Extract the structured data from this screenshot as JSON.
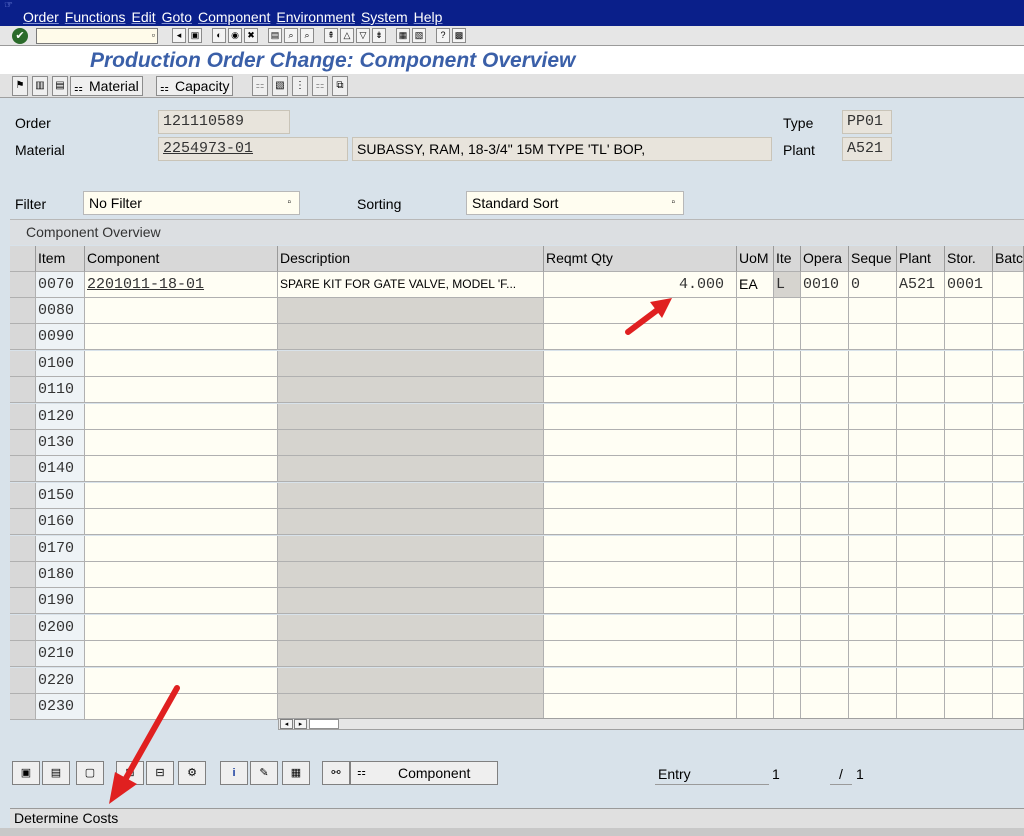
{
  "menu": [
    "Order",
    "Functions",
    "Edit",
    "Goto",
    "Component",
    "Environment",
    "System",
    "Help"
  ],
  "title": "Production Order Change: Component Overview",
  "app_toolbar": {
    "material_label": "Material",
    "capacity_label": "Capacity"
  },
  "header": {
    "order_label": "Order",
    "order_value": "121110589",
    "material_label": "Material",
    "material_value": "2254973-01",
    "material_desc": "SUBASSY, RAM, 18-3/4\" 15M TYPE 'TL' BOP,",
    "type_label": "Type",
    "type_value": "PP01",
    "plant_label": "Plant",
    "plant_value": "A521",
    "filter_label": "Filter",
    "filter_value": "No Filter",
    "sorting_label": "Sorting",
    "sorting_value": "Standard Sort"
  },
  "table": {
    "title": "Component Overview",
    "columns": [
      "Item",
      "Component",
      "Description",
      "Reqmt Qty",
      "UoM",
      "Ite",
      "Opera",
      "Seque",
      "Plant",
      "Stor.",
      "Batch"
    ],
    "first_row": {
      "item": "0070",
      "component": "2201011-18-01",
      "description": "SPARE KIT FOR GATE VALVE, MODEL 'F...",
      "qty": "4.000",
      "uom": "EA",
      "ite": "L",
      "opera": "0010",
      "seque": "0",
      "plant": "A521",
      "stor": "0001"
    },
    "empty_items": [
      "0080",
      "0090",
      "0100",
      "0110",
      "0120",
      "0130",
      "0140",
      "0150",
      "0160",
      "0170",
      "0180",
      "0190",
      "0200",
      "0210",
      "0220",
      "0230"
    ]
  },
  "bottom": {
    "component_button": "Component",
    "entry_label": "Entry",
    "entry_value": "1",
    "slash": "/",
    "total_value": "1"
  },
  "status_text": "Determine Costs",
  "colors": {
    "menubar": "#0a1f8a",
    "title_text": "#3a5fa8",
    "arrow": "#e02020"
  }
}
